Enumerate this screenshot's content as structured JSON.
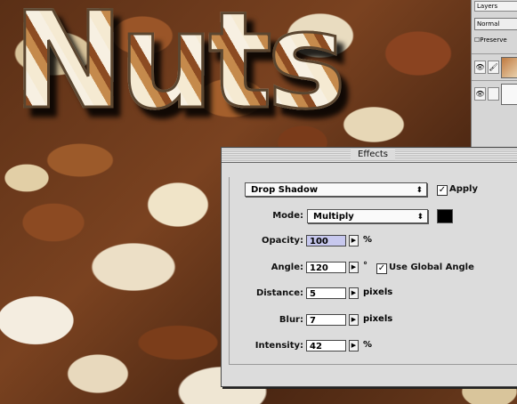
{
  "canvas": {
    "title_word": "Nuts"
  },
  "layers_palette": {
    "tab": "Layers",
    "blend_mode": "Normal",
    "preserve": "Preserve",
    "rows": [
      {
        "eye": "👁",
        "brush": "🖌"
      },
      {
        "eye": "👁",
        "brush": ""
      }
    ]
  },
  "effects": {
    "title": "Effects",
    "effect_type": "Drop Shadow",
    "apply_label": "Apply",
    "apply_checked": true,
    "mode_label": "Mode:",
    "mode_value": "Multiply",
    "shadow_color": "#000000",
    "opacity_label": "Opacity:",
    "opacity_value": "100",
    "opacity_unit": "%",
    "angle_label": "Angle:",
    "angle_value": "120",
    "angle_unit": "°",
    "global_angle_label": "Use Global Angle",
    "global_angle_checked": true,
    "distance_label": "Distance:",
    "distance_value": "5",
    "distance_unit": "pixels",
    "blur_label": "Blur:",
    "blur_value": "7",
    "blur_unit": "pixels",
    "intensity_label": "Intensity:",
    "intensity_value": "42",
    "intensity_unit": "%",
    "popup_arrows": "⬍",
    "stepper_arrow": "▶",
    "check_mark": "✓"
  }
}
